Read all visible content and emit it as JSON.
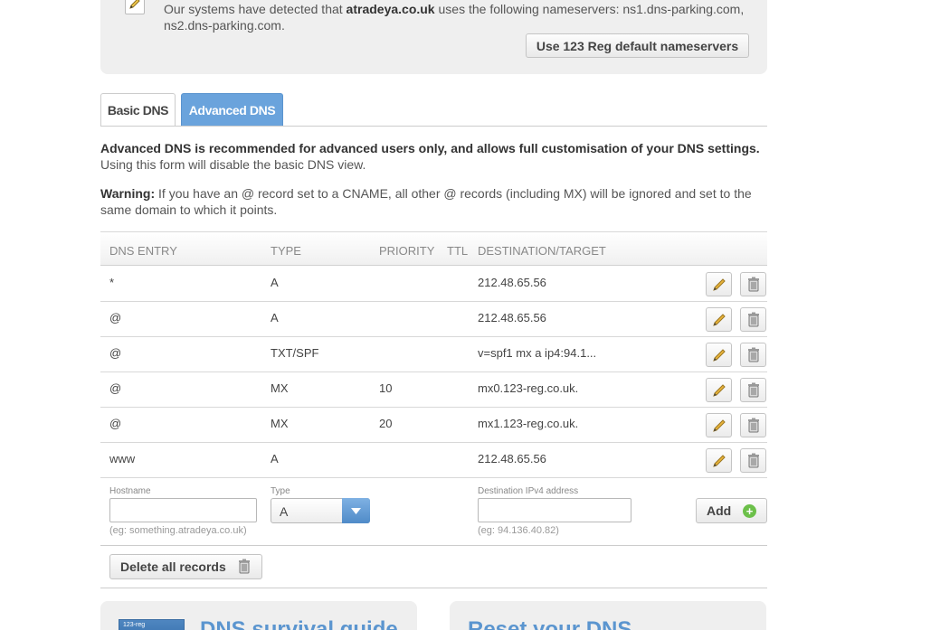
{
  "notice": {
    "text_prefix": "Our systems have detected that ",
    "domain": "atradeya.co.uk",
    "text_suffix": " uses the following nameservers: ns1.dns-parking.com, ns2.dns-parking.com.",
    "button_label": "Use 123 Reg default nameservers"
  },
  "tabs": [
    {
      "label": "Basic DNS",
      "active": false
    },
    {
      "label": "Advanced DNS",
      "active": true
    }
  ],
  "intro": {
    "bold": "Advanced DNS is recommended for advanced users only, and allows full customisation of your DNS settings.",
    "text": "Using this form will disable the basic DNS view."
  },
  "warning": {
    "label": "Warning:",
    "text": " If you have an @ record set to a CNAME, all other @ records (including MX) will be ignored and set to the same domain to which it points."
  },
  "table": {
    "headers": {
      "entry": "DNS ENTRY",
      "type": "TYPE",
      "priority": "PRIORITY",
      "ttl": "TTL",
      "destination": "DESTINATION/TARGET"
    },
    "rows": [
      {
        "entry": "*",
        "type": "A",
        "priority": "",
        "ttl": "",
        "destination": "212.48.65.56"
      },
      {
        "entry": "@",
        "type": "A",
        "priority": "",
        "ttl": "",
        "destination": "212.48.65.56"
      },
      {
        "entry": "@",
        "type": "TXT/SPF",
        "priority": "",
        "ttl": "",
        "destination": "v=spf1 mx a ip4:94.1..."
      },
      {
        "entry": "@",
        "type": "MX",
        "priority": "10",
        "ttl": "",
        "destination": "mx0.123-reg.co.uk."
      },
      {
        "entry": "@",
        "type": "MX",
        "priority": "20",
        "ttl": "",
        "destination": "mx1.123-reg.co.uk."
      },
      {
        "entry": "www",
        "type": "A",
        "priority": "",
        "ttl": "",
        "destination": "212.48.65.56"
      }
    ]
  },
  "add_form": {
    "hostname_label": "Hostname",
    "hostname_value": "",
    "hostname_hint": "(eg: something.atradeya.co.uk)",
    "type_label": "Type",
    "type_value": "A",
    "destination_label": "Destination IPv4 address",
    "destination_value": "",
    "destination_hint": "(eg: 94.136.40.82)",
    "add_label": "Add"
  },
  "delete_all_label": "Delete all records",
  "bottom": {
    "guide_title": "DNS survival guide",
    "guide_thumb_text": "123-reg",
    "reset_title": "Reset your DNS"
  },
  "colors": {
    "accent": "#6aa3dc",
    "title_blue": "#5b95cf",
    "add_green": "#6cc04a"
  }
}
